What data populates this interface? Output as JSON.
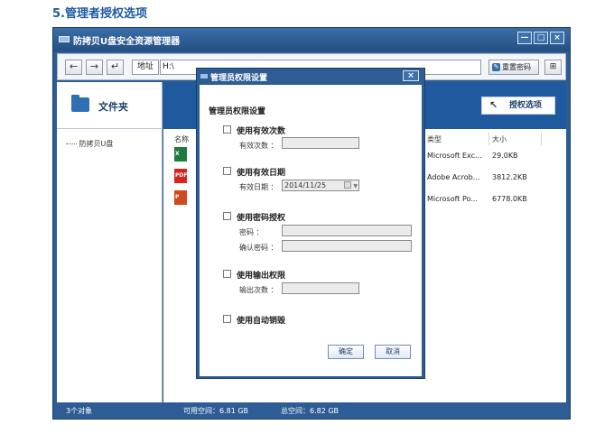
{
  "page_heading": "5.管理者授权选项",
  "window": {
    "title": "防拷贝U盘安全资源管理器",
    "minimize": "—",
    "maximize": "□",
    "close": "×"
  },
  "toolbar": {
    "back": "←",
    "forward": "→",
    "up": "↵",
    "address_label": "地址",
    "address_value": "H:\\",
    "reset_password": "重置密码",
    "view_toggle": "⊞"
  },
  "left_pane": {
    "title": "文件夹",
    "tree_item": "防拷贝U盘"
  },
  "right_pane": {
    "authorize_button": "授权选项",
    "columns": {
      "name": "名称",
      "type": "类型",
      "size": "大小"
    },
    "files": [
      {
        "icon": "excel-icon",
        "type": "Microsoft Exc...",
        "size": "29.0KB"
      },
      {
        "icon": "pdf-icon",
        "type": "Adobe Acrob...",
        "size": "3812.2KB"
      },
      {
        "icon": "ppt-icon",
        "type": "Microsoft Po...",
        "size": "6778.0KB"
      }
    ]
  },
  "status": {
    "objects": "3个对象",
    "available": "可用空间：6.81 GB",
    "total": "总空间：6.82 GB"
  },
  "dialog": {
    "title": "管理员权限设置",
    "close": "×",
    "heading": "管理员权限设置",
    "options": {
      "count_label": "使用有效次数",
      "count_field_label": "有效次数 ：",
      "count_value": "",
      "date_label": "使用有效日期",
      "date_field_label": "有效日期 ：",
      "date_value": "2014/11/25",
      "password_label": "使用密码授权",
      "password_field_label": "密码 ：",
      "confirm_field_label": "确认密码 ：",
      "password_value": "",
      "confirm_value": "",
      "output_label": "使用输出权限",
      "output_field_label": "输出次数 ：",
      "output_value": "",
      "autodestroy_label": "使用自动销毁"
    },
    "ok": "确定",
    "cancel": "取消"
  },
  "colors": {
    "window_blue": "#2d5d94",
    "banner_blue": "#1f5a9e",
    "heading_blue": "#1e5aa8"
  }
}
